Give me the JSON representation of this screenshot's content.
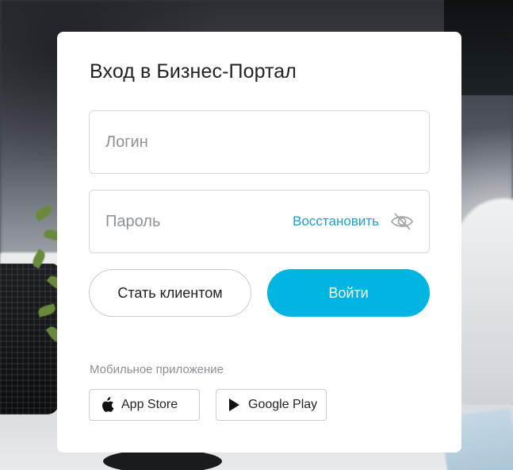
{
  "login_card": {
    "title": "Вход в Бизнес-Портал",
    "login_placeholder": "Логин",
    "password_placeholder": "Пароль",
    "restore_link": "Восстановить",
    "become_client_button": "Стать клиентом",
    "login_button": "Войти",
    "mobile_app_label": "Мобильное приложение",
    "app_store_label": "App Store",
    "google_play_label": "Google Play"
  },
  "colors": {
    "accent": "#00b5e2",
    "link": "#1a9ed4"
  },
  "icons": {
    "password_toggle": "eye-off-icon",
    "app_store": "apple-icon",
    "google_play": "play-icon"
  }
}
